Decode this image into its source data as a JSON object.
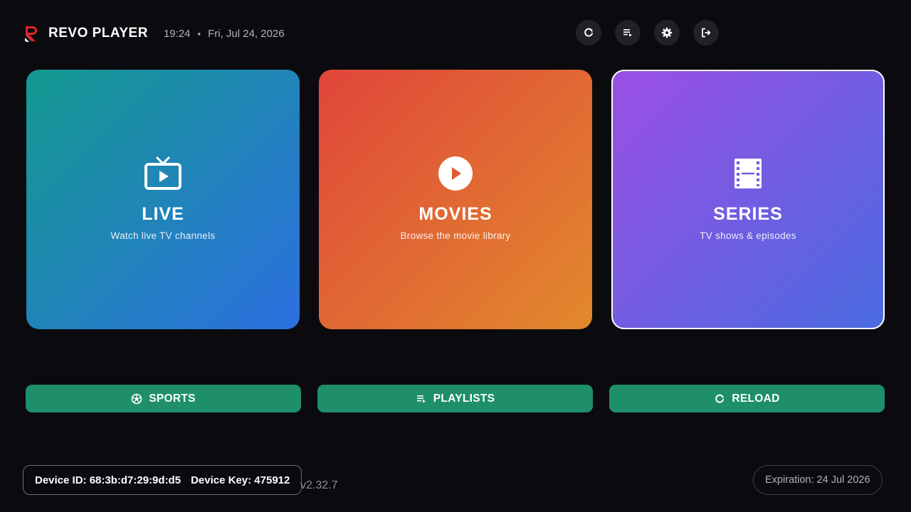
{
  "header": {
    "app_title": "REVO PLAYER",
    "time": "19:24",
    "separator": "•",
    "date": "Fri, Jul 24, 2026",
    "actions": [
      {
        "icon": "refresh-icon"
      },
      {
        "icon": "playlist-icon"
      },
      {
        "icon": "gear-icon"
      },
      {
        "icon": "logout-icon"
      }
    ]
  },
  "cards": {
    "live": {
      "title": "LIVE",
      "subtitle": "Watch live TV channels",
      "icon": "tv-icon"
    },
    "movies": {
      "title": "MOVIES",
      "subtitle": "Browse the movie library",
      "icon": "play-circle-icon"
    },
    "series": {
      "title": "SERIES",
      "subtitle": "TV shows & episodes",
      "icon": "film-icon",
      "focused": true
    }
  },
  "buttons": {
    "sports": {
      "label": "SPORTS",
      "icon": "soccer-ball-icon"
    },
    "playlists": {
      "label": "PLAYLISTS",
      "icon": "playlist-icon"
    },
    "reload": {
      "label": "RELOAD",
      "icon": "refresh-icon"
    }
  },
  "footer": {
    "device_id": "Device ID: 68:3b:d7:29:9d:d5",
    "device_key": "Device Key: 475912",
    "version": "v2.32.7",
    "expiration": "Expiration: 24 Jul 2026"
  },
  "colors": {
    "background": "#0b0b0f",
    "button_green": "#1e8f6a",
    "logo_red": "#e2262d"
  }
}
